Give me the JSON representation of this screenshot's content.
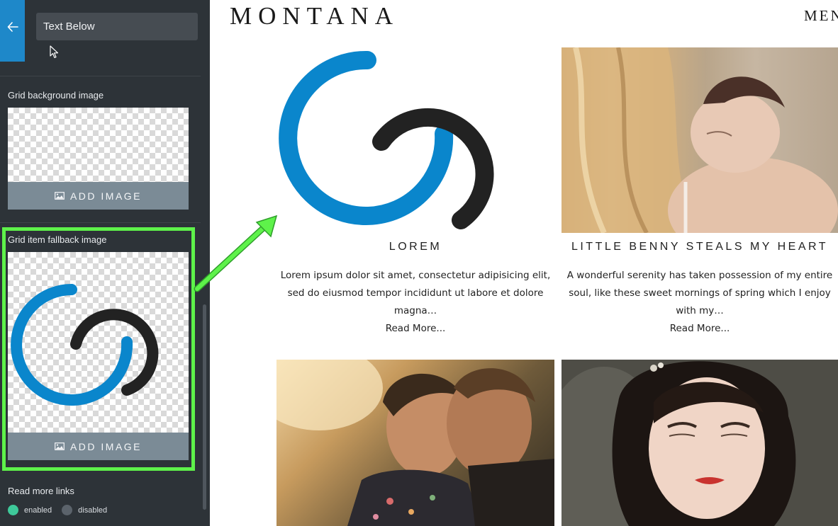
{
  "sidebar": {
    "layout_select_value": "Text Below",
    "grid_background_label": "Grid background image",
    "grid_fallback_label": "Grid item fallback image",
    "add_image_label": "ADD IMAGE",
    "read_more_label": "Read more links",
    "read_more_options": [
      "enabled",
      "disabled"
    ],
    "read_more_selected": "enabled"
  },
  "site": {
    "logo": "MONTANA",
    "menu": "MEN"
  },
  "grid": {
    "items": [
      {
        "title": "LOREM",
        "text": "Lorem ipsum dolor sit amet, consectetur adipisicing elit, sed do eiusmod tempor incididunt ut labore et dolore magna…",
        "read_more": "Read More..."
      },
      {
        "title": "LITTLE BENNY STEALS MY HEART",
        "text": "A wonderful serenity has taken possession of my entire soul, like these sweet mornings of spring which I enjoy with my…",
        "read_more": "Read More..."
      }
    ]
  },
  "colors": {
    "accent_blue": "#1e88c9",
    "logo_blue": "#0a86cc",
    "logo_dark": "#222222",
    "highlight_green": "#5ef24a",
    "enabled_green": "#3ec99a"
  },
  "icons": [
    "arrow-left-icon",
    "image-icon",
    "cursor-icon"
  ]
}
